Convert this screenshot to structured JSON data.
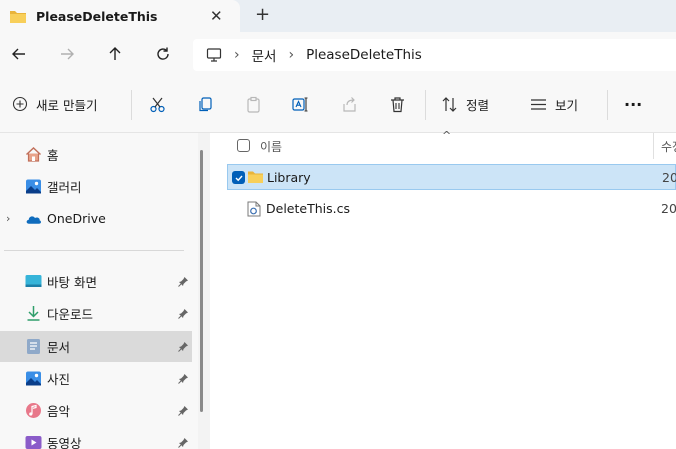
{
  "tab": {
    "title": "PleaseDeleteThis",
    "close_glyph": "✕",
    "new_tab_glyph": "+"
  },
  "address": {
    "crumbs": [
      "문서",
      "PleaseDeleteThis"
    ],
    "separator": "›"
  },
  "commands": {
    "new_label": "새로 만들기",
    "sort_label": "정렬",
    "view_label": "보기",
    "more_glyph": "···"
  },
  "sidebar": {
    "items": [
      {
        "label": "홈",
        "icon": "home-icon"
      },
      {
        "label": "갤러리",
        "icon": "gallery-icon"
      },
      {
        "label": "OneDrive",
        "icon": "onedrive-icon",
        "expandable": true
      },
      {
        "label": "바탕 화면",
        "icon": "desktop-icon",
        "pinned": true
      },
      {
        "label": "다운로드",
        "icon": "download-icon",
        "pinned": true
      },
      {
        "label": "문서",
        "icon": "documents-icon",
        "pinned": true,
        "active": true
      },
      {
        "label": "사진",
        "icon": "pictures-icon",
        "pinned": true
      },
      {
        "label": "음악",
        "icon": "music-icon",
        "pinned": true
      },
      {
        "label": "동영상",
        "icon": "videos-icon",
        "pinned": true
      }
    ],
    "expander_glyph": "›"
  },
  "columns": {
    "name": "이름",
    "date": "수정",
    "sort_glyph": "^"
  },
  "files": [
    {
      "name": "Library",
      "type": "folder",
      "date": "20",
      "selected": true
    },
    {
      "name": "DeleteThis.cs",
      "type": "cs-file",
      "date": "20",
      "selected": false
    }
  ],
  "colors": {
    "accent": "#005fb8",
    "selection": "#cce4f7",
    "folder": "#f4c44e"
  }
}
